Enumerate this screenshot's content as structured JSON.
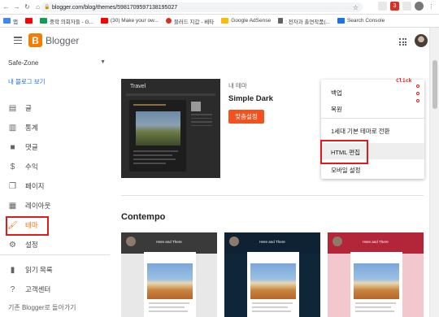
{
  "browser": {
    "url": "blogger.com/blog/themes/5981709597138195027",
    "bookmarks": [
      {
        "label": "앱",
        "color": "#4285f4"
      },
      {
        "label": "",
        "color": "#ff0000"
      },
      {
        "label": "중학 의회자들 - G...",
        "color": "#0f9d58"
      },
      {
        "label": "(30) Make your ow...",
        "color": "#ff0000"
      },
      {
        "label": "블러드 지갑 - 베타",
        "color": "#d93025"
      },
      {
        "label": "Google AdSense",
        "color": "#fbbc04"
      },
      {
        "label": ": 전자과 출연작품(...",
        "color": "#5f6368"
      },
      {
        "label": "Search Console",
        "color": "#1a73e8"
      }
    ]
  },
  "header": {
    "logo_letter": "B",
    "app_name": "Blogger"
  },
  "sidebar": {
    "blog_name": "Safe-Zone",
    "view_blog": "내 블로그 보기",
    "items": [
      {
        "label": "글",
        "icon": "posts-icon"
      },
      {
        "label": "통계",
        "icon": "stats-icon"
      },
      {
        "label": "댓글",
        "icon": "comments-icon"
      },
      {
        "label": "수익",
        "icon": "earnings-icon"
      },
      {
        "label": "페이지",
        "icon": "pages-icon"
      },
      {
        "label": "레이아웃",
        "icon": "layout-icon"
      },
      {
        "label": "테마",
        "icon": "theme-icon"
      },
      {
        "label": "설정",
        "icon": "settings-icon"
      },
      {
        "label": "읽기 목록",
        "icon": "reading-list-icon"
      },
      {
        "label": "고객센터",
        "icon": "help-icon"
      }
    ],
    "legacy": "기존 Blogger로 돌아가기"
  },
  "current_theme": {
    "preview_title": "Travel",
    "label": "내 테마",
    "name": "Simple Dark",
    "customize": "맞춤설정"
  },
  "gallery": {
    "section": "Contempo",
    "themes": [
      {
        "header_text": "Here and There",
        "header_color": "#3a3a3a",
        "bg": "#e8e8e8"
      },
      {
        "header_text": "Here and There",
        "header_color": "#0e2233",
        "bg": "#0f2638"
      },
      {
        "header_text": "Here and There",
        "header_color": "#b3263a",
        "bg": "#f3c7ce"
      }
    ]
  },
  "menu": {
    "items": [
      "백업",
      "복원",
      "1세대 기본 테마로 전환",
      "HTML 편집",
      "모바일 설정"
    ],
    "annotation": "Click"
  },
  "colors": {
    "accent": "#f4511e",
    "highlight": "#e01b1b",
    "link": "#1a73e8"
  }
}
